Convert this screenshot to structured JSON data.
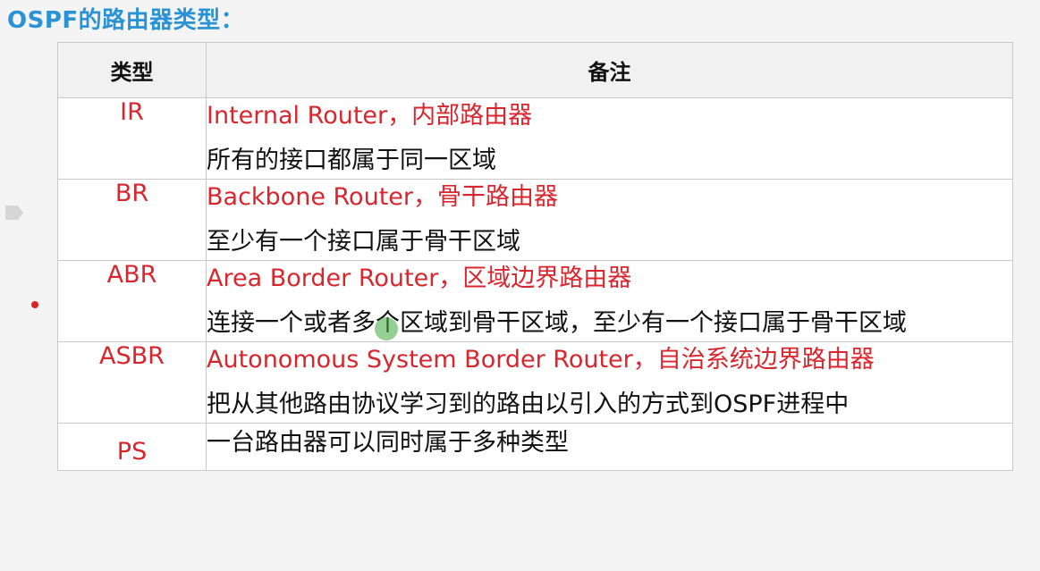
{
  "title": "OSPF的路由器类型：",
  "table": {
    "headers": [
      "类型",
      "备注"
    ],
    "rows": [
      {
        "type": "IR",
        "note_red": "Internal Router，内部路由器",
        "note_black": "所有的接口都属于同一区域"
      },
      {
        "type": "BR",
        "note_red": "Backbone Router，骨干路由器",
        "note_black": "至少有一个接口属于骨干区域"
      },
      {
        "type": "ABR",
        "note_red": "Area Border Router，区域边界路由器",
        "note_black": "连接一个或者多个区域到骨干区域，至少有一个接口属于骨干区域"
      },
      {
        "type": "ASBR",
        "note_red": "Autonomous System Border Router，自治系统边界路由器",
        "note_black": "把从其他路由协议学习到的路由以引入的方式到OSPF进程中"
      },
      {
        "type": "PS",
        "note_red": "",
        "note_black": "一台路由器可以同时属于多种类型"
      }
    ]
  },
  "colors": {
    "title": "#2a93d5",
    "accent_red": "#d8262e"
  }
}
